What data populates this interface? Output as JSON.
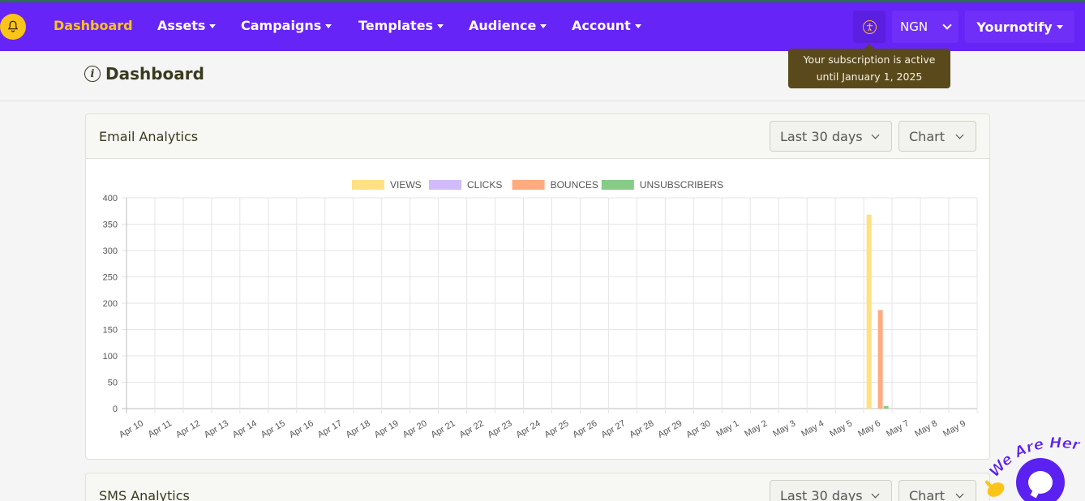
{
  "nav": {
    "items": [
      {
        "label": "Dashboard",
        "active": true,
        "dropdown": false
      },
      {
        "label": "Assets",
        "active": false,
        "dropdown": true
      },
      {
        "label": "Campaigns",
        "active": false,
        "dropdown": true
      },
      {
        "label": "Templates",
        "active": false,
        "dropdown": true
      },
      {
        "label": "Audience",
        "active": false,
        "dropdown": true
      },
      {
        "label": "Account",
        "active": false,
        "dropdown": true
      }
    ],
    "currency": "NGN",
    "user_menu": "Yournotify"
  },
  "tooltip": {
    "line1": "Your subscription is active",
    "line2": "until January 1, 2025"
  },
  "page_title": "Dashboard",
  "email_card": {
    "title": "Email Analytics",
    "range": "Last 30 days",
    "view": "Chart"
  },
  "sms_card": {
    "title": "SMS Analytics",
    "range": "Last 30 days",
    "view": "Chart"
  },
  "chat_widget": {
    "tagline": "We Are Here!"
  },
  "colors": {
    "navbar": "#6624f7",
    "active_nav": "#fcc419",
    "views": "#ffe082",
    "clicks": "#d1bbfb",
    "bounces": "#ffab80",
    "unsubscribers": "#86cc86"
  },
  "chart_data": {
    "type": "bar",
    "title": "",
    "xlabel": "",
    "ylabel": "",
    "ylim": [
      0,
      400
    ],
    "yticks": [
      0,
      50,
      100,
      150,
      200,
      250,
      300,
      350,
      400
    ],
    "grid": true,
    "legend_position": "top",
    "categories": [
      "Apr 10",
      "Apr 11",
      "Apr 12",
      "Apr 13",
      "Apr 14",
      "Apr 15",
      "Apr 16",
      "Apr 17",
      "Apr 18",
      "Apr 19",
      "Apr 20",
      "Apr 21",
      "Apr 22",
      "Apr 23",
      "Apr 24",
      "Apr 25",
      "Apr 26",
      "Apr 27",
      "Apr 28",
      "Apr 29",
      "Apr 30",
      "May 1",
      "May 2",
      "May 3",
      "May 4",
      "May 5",
      "May 6",
      "May 7",
      "May 8",
      "May 9"
    ],
    "series": [
      {
        "name": "VIEWS",
        "color": "#ffe082",
        "values": [
          0,
          0,
          0,
          0,
          0,
          0,
          0,
          0,
          0,
          0,
          0,
          0,
          0,
          0,
          0,
          0,
          0,
          0,
          0,
          0,
          0,
          0,
          0,
          0,
          0,
          0,
          368,
          0,
          0,
          0
        ]
      },
      {
        "name": "CLICKS",
        "color": "#d1bbfb",
        "values": [
          0,
          0,
          0,
          0,
          0,
          0,
          0,
          0,
          0,
          0,
          0,
          0,
          0,
          0,
          0,
          0,
          0,
          0,
          0,
          0,
          0,
          0,
          0,
          0,
          0,
          0,
          0,
          0,
          0,
          0
        ]
      },
      {
        "name": "BOUNCES",
        "color": "#ffab80",
        "values": [
          0,
          0,
          0,
          0,
          0,
          0,
          0,
          0,
          0,
          0,
          0,
          0,
          0,
          0,
          0,
          0,
          0,
          0,
          0,
          0,
          0,
          0,
          0,
          0,
          0,
          0,
          187,
          0,
          0,
          0
        ]
      },
      {
        "name": "UNSUBSCRIBERS",
        "color": "#86cc86",
        "values": [
          0,
          0,
          0,
          0,
          0,
          0,
          0,
          0,
          0,
          0,
          0,
          0,
          0,
          0,
          0,
          0,
          0,
          0,
          0,
          0,
          0,
          0,
          0,
          0,
          0,
          0,
          5,
          0,
          0,
          0
        ]
      }
    ]
  }
}
